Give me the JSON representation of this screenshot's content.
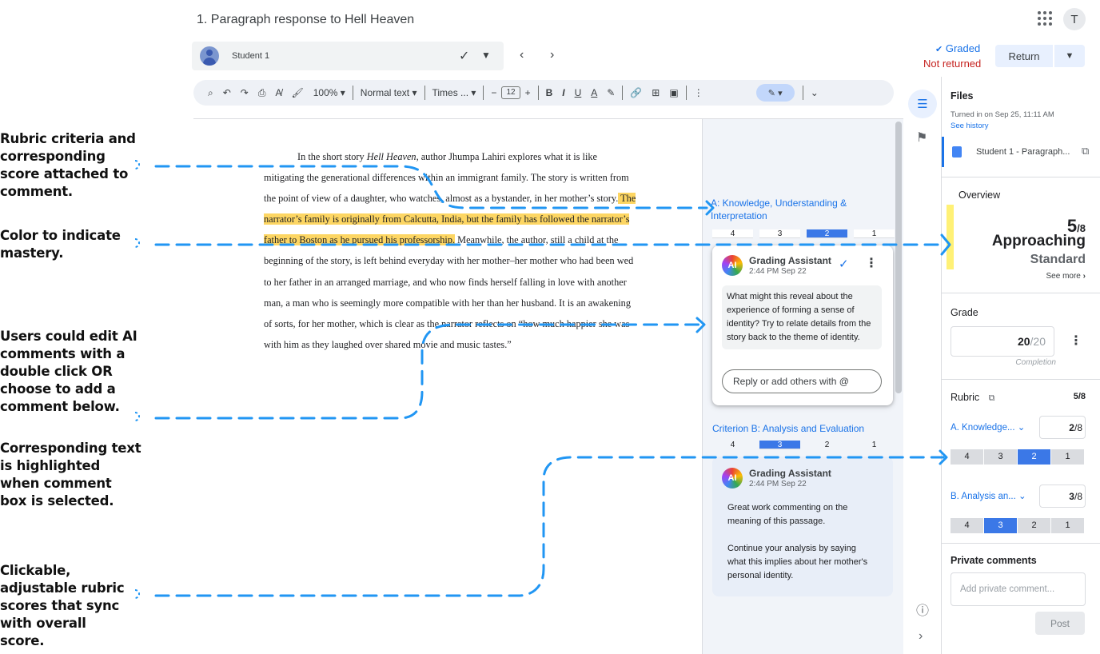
{
  "header": {
    "title": "1. Paragraph response to Hell Heaven",
    "avatar_letter": "T",
    "student_name": "Student 1",
    "status_graded": "Graded",
    "status_not_returned": "Not returned",
    "return_label": "Return"
  },
  "toolbar": {
    "zoom": "100%",
    "style": "Normal text",
    "font": "Times ...",
    "font_size": "12"
  },
  "document": {
    "p1": "In the short story ",
    "p1_italic": "Hell Heaven",
    "p1b": ", author Jhumpa Lahiri explores what it is like mitigating the generational differences within an immigrant family. The story is written from the point of view of a daughter, who watches, almost as a bystander, in her mother’s story.",
    "highlight": " The narrator’s family is originally from Calcutta, India, but the family has followed the narrator’s father to Boston as he pursued his professorship.",
    "p2": " Meanwhile, the author, still a child at the beginning of the story, is left behind everyday with her mother–her mother who had been wed to her father in an arranged marriage, and who now finds herself falling in love with another man, a man who is seemingly more compatible with her than her husband. It is an awakening of sorts, for her mother, which is clear as the narrator reflects on “how much happier she was with him as they laughed over shared movie and music tastes.”"
  },
  "comments": {
    "criterion_a_title": "A: Knowledge, Understanding & Interpretation",
    "criterion_a_scores": [
      "4",
      "3",
      "2",
      "1"
    ],
    "criterion_a_selected": "2",
    "comment1": {
      "ai_badge": "AI",
      "author": "Grading Assistant",
      "time": "2:44 PM Sep 22",
      "text": "What might this reveal about the experience of forming a sense of identity? Try to relate details from the story back to the theme of identity.",
      "reply_placeholder": "Reply or add others with @"
    },
    "criterion_b_title": "Criterion B: Analysis and Evaluation",
    "criterion_b_scores": [
      "4",
      "3",
      "2",
      "1"
    ],
    "criterion_b_selected": "3",
    "comment2": {
      "ai_badge": "AI",
      "author": "Grading Assistant",
      "time": "2:44 PM Sep 22",
      "text1": "Great work commenting on the meaning of this passage.",
      "text2": "Continue your analysis by saying what this implies about her mother's personal identity."
    }
  },
  "right_panel": {
    "files_title": "Files",
    "turned_in": "Turned in on Sep 25, 11:11 AM",
    "see_history": "See history",
    "file_name": "Student 1 - Paragraph...",
    "overview_title": "Overview",
    "overview_score": "5",
    "overview_denom": "/8",
    "overview_level": "Approaching",
    "overview_level2": "Standard",
    "see_more": "See more",
    "mastery_color": "#fff176",
    "grade_title": "Grade",
    "grade_value": "20",
    "grade_denom": "/20",
    "grade_caption": "Completion",
    "rubric_title": "Rubric",
    "rubric_total": "5/8",
    "rubric_a_label": "A. Knowledge...",
    "rubric_a_score": "2",
    "rubric_a_denom": "/8",
    "rubric_a_scores": [
      "4",
      "3",
      "2",
      "1"
    ],
    "rubric_a_selected": "2",
    "rubric_b_label": "B. Analysis an...",
    "rubric_b_score": "3",
    "rubric_b_denom": "/8",
    "rubric_b_scores": [
      "4",
      "3",
      "2",
      "1"
    ],
    "rubric_b_selected": "3",
    "private_title": "Private comments",
    "private_placeholder": "Add private comment...",
    "post_label": "Post"
  },
  "annotations": {
    "a1": "Rubric criteria and corresponding score attached to comment.",
    "a2": "Color to indicate mastery.",
    "a3": "Users could edit AI comments with a double click OR choose to add a comment below.",
    "a4": "Corresponding text is highlighted when comment box is selected.",
    "a5": "Clickable, adjustable rubric scores that sync with overall score."
  },
  "colors": {
    "accent": "#1a73e8",
    "highlight": "#fdd663",
    "annotation_line": "#2196f3",
    "selected_score": "#3b78e7"
  }
}
